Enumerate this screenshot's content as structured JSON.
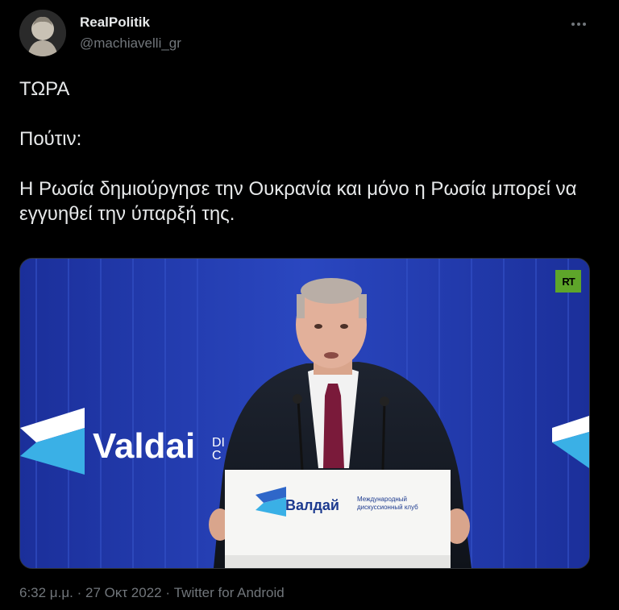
{
  "author": {
    "display_name": "RealPolitik",
    "handle": "@machiavelli_gr"
  },
  "tweet": {
    "lines": [
      "ΤΩΡΑ",
      "",
      "Πούτιν:",
      "",
      "Η Ρωσία δημιούργησε την Ουκρανία και μόνο η Ρωσία μπορεί να εγγυηθεί την ύπαρξή της."
    ]
  },
  "media": {
    "channel_badge": "RT",
    "backdrop_brand": "Valdai",
    "backdrop_brand_suffix": "DI\nC",
    "podium_brand": "Валдай",
    "podium_tagline": "Международный дискуссионный клуб"
  },
  "footer": {
    "time": "6:32 μ.μ.",
    "separator": "·",
    "date": "27 Οκτ 2022",
    "source": "Twitter for Android"
  },
  "colors": {
    "background": "#000000",
    "text": "#e7e9ea",
    "secondary": "#71767b",
    "video_backdrop": "#1a3aa8"
  },
  "icons": {
    "more": "more-horizontal-icon"
  }
}
